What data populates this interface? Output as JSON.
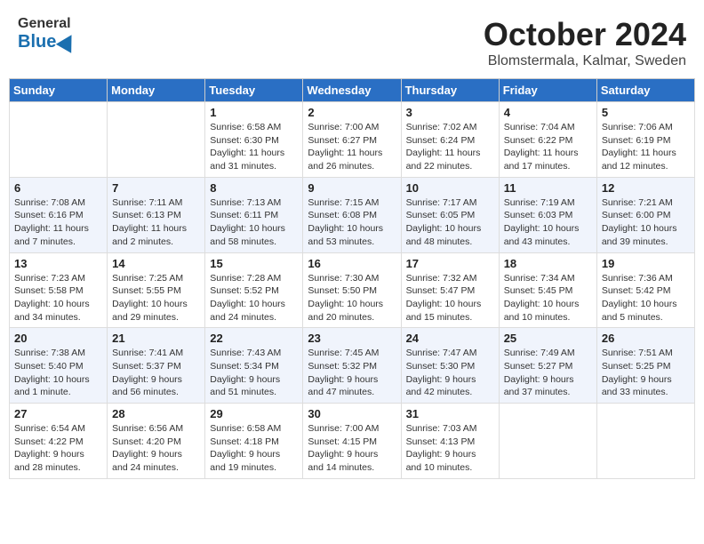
{
  "header": {
    "logo_general": "General",
    "logo_blue": "Blue",
    "month": "October 2024",
    "location": "Blomstermala, Kalmar, Sweden"
  },
  "weekdays": [
    "Sunday",
    "Monday",
    "Tuesday",
    "Wednesday",
    "Thursday",
    "Friday",
    "Saturday"
  ],
  "weeks": [
    [
      {
        "day": "",
        "sunrise": "",
        "sunset": "",
        "daylight": ""
      },
      {
        "day": "",
        "sunrise": "",
        "sunset": "",
        "daylight": ""
      },
      {
        "day": "1",
        "sunrise": "Sunrise: 6:58 AM",
        "sunset": "Sunset: 6:30 PM",
        "daylight": "Daylight: 11 hours and 31 minutes."
      },
      {
        "day": "2",
        "sunrise": "Sunrise: 7:00 AM",
        "sunset": "Sunset: 6:27 PM",
        "daylight": "Daylight: 11 hours and 26 minutes."
      },
      {
        "day": "3",
        "sunrise": "Sunrise: 7:02 AM",
        "sunset": "Sunset: 6:24 PM",
        "daylight": "Daylight: 11 hours and 22 minutes."
      },
      {
        "day": "4",
        "sunrise": "Sunrise: 7:04 AM",
        "sunset": "Sunset: 6:22 PM",
        "daylight": "Daylight: 11 hours and 17 minutes."
      },
      {
        "day": "5",
        "sunrise": "Sunrise: 7:06 AM",
        "sunset": "Sunset: 6:19 PM",
        "daylight": "Daylight: 11 hours and 12 minutes."
      }
    ],
    [
      {
        "day": "6",
        "sunrise": "Sunrise: 7:08 AM",
        "sunset": "Sunset: 6:16 PM",
        "daylight": "Daylight: 11 hours and 7 minutes."
      },
      {
        "day": "7",
        "sunrise": "Sunrise: 7:11 AM",
        "sunset": "Sunset: 6:13 PM",
        "daylight": "Daylight: 11 hours and 2 minutes."
      },
      {
        "day": "8",
        "sunrise": "Sunrise: 7:13 AM",
        "sunset": "Sunset: 6:11 PM",
        "daylight": "Daylight: 10 hours and 58 minutes."
      },
      {
        "day": "9",
        "sunrise": "Sunrise: 7:15 AM",
        "sunset": "Sunset: 6:08 PM",
        "daylight": "Daylight: 10 hours and 53 minutes."
      },
      {
        "day": "10",
        "sunrise": "Sunrise: 7:17 AM",
        "sunset": "Sunset: 6:05 PM",
        "daylight": "Daylight: 10 hours and 48 minutes."
      },
      {
        "day": "11",
        "sunrise": "Sunrise: 7:19 AM",
        "sunset": "Sunset: 6:03 PM",
        "daylight": "Daylight: 10 hours and 43 minutes."
      },
      {
        "day": "12",
        "sunrise": "Sunrise: 7:21 AM",
        "sunset": "Sunset: 6:00 PM",
        "daylight": "Daylight: 10 hours and 39 minutes."
      }
    ],
    [
      {
        "day": "13",
        "sunrise": "Sunrise: 7:23 AM",
        "sunset": "Sunset: 5:58 PM",
        "daylight": "Daylight: 10 hours and 34 minutes."
      },
      {
        "day": "14",
        "sunrise": "Sunrise: 7:25 AM",
        "sunset": "Sunset: 5:55 PM",
        "daylight": "Daylight: 10 hours and 29 minutes."
      },
      {
        "day": "15",
        "sunrise": "Sunrise: 7:28 AM",
        "sunset": "Sunset: 5:52 PM",
        "daylight": "Daylight: 10 hours and 24 minutes."
      },
      {
        "day": "16",
        "sunrise": "Sunrise: 7:30 AM",
        "sunset": "Sunset: 5:50 PM",
        "daylight": "Daylight: 10 hours and 20 minutes."
      },
      {
        "day": "17",
        "sunrise": "Sunrise: 7:32 AM",
        "sunset": "Sunset: 5:47 PM",
        "daylight": "Daylight: 10 hours and 15 minutes."
      },
      {
        "day": "18",
        "sunrise": "Sunrise: 7:34 AM",
        "sunset": "Sunset: 5:45 PM",
        "daylight": "Daylight: 10 hours and 10 minutes."
      },
      {
        "day": "19",
        "sunrise": "Sunrise: 7:36 AM",
        "sunset": "Sunset: 5:42 PM",
        "daylight": "Daylight: 10 hours and 5 minutes."
      }
    ],
    [
      {
        "day": "20",
        "sunrise": "Sunrise: 7:38 AM",
        "sunset": "Sunset: 5:40 PM",
        "daylight": "Daylight: 10 hours and 1 minute."
      },
      {
        "day": "21",
        "sunrise": "Sunrise: 7:41 AM",
        "sunset": "Sunset: 5:37 PM",
        "daylight": "Daylight: 9 hours and 56 minutes."
      },
      {
        "day": "22",
        "sunrise": "Sunrise: 7:43 AM",
        "sunset": "Sunset: 5:34 PM",
        "daylight": "Daylight: 9 hours and 51 minutes."
      },
      {
        "day": "23",
        "sunrise": "Sunrise: 7:45 AM",
        "sunset": "Sunset: 5:32 PM",
        "daylight": "Daylight: 9 hours and 47 minutes."
      },
      {
        "day": "24",
        "sunrise": "Sunrise: 7:47 AM",
        "sunset": "Sunset: 5:30 PM",
        "daylight": "Daylight: 9 hours and 42 minutes."
      },
      {
        "day": "25",
        "sunrise": "Sunrise: 7:49 AM",
        "sunset": "Sunset: 5:27 PM",
        "daylight": "Daylight: 9 hours and 37 minutes."
      },
      {
        "day": "26",
        "sunrise": "Sunrise: 7:51 AM",
        "sunset": "Sunset: 5:25 PM",
        "daylight": "Daylight: 9 hours and 33 minutes."
      }
    ],
    [
      {
        "day": "27",
        "sunrise": "Sunrise: 6:54 AM",
        "sunset": "Sunset: 4:22 PM",
        "daylight": "Daylight: 9 hours and 28 minutes."
      },
      {
        "day": "28",
        "sunrise": "Sunrise: 6:56 AM",
        "sunset": "Sunset: 4:20 PM",
        "daylight": "Daylight: 9 hours and 24 minutes."
      },
      {
        "day": "29",
        "sunrise": "Sunrise: 6:58 AM",
        "sunset": "Sunset: 4:18 PM",
        "daylight": "Daylight: 9 hours and 19 minutes."
      },
      {
        "day": "30",
        "sunrise": "Sunrise: 7:00 AM",
        "sunset": "Sunset: 4:15 PM",
        "daylight": "Daylight: 9 hours and 14 minutes."
      },
      {
        "day": "31",
        "sunrise": "Sunrise: 7:03 AM",
        "sunset": "Sunset: 4:13 PM",
        "daylight": "Daylight: 9 hours and 10 minutes."
      },
      {
        "day": "",
        "sunrise": "",
        "sunset": "",
        "daylight": ""
      },
      {
        "day": "",
        "sunrise": "",
        "sunset": "",
        "daylight": ""
      }
    ]
  ]
}
